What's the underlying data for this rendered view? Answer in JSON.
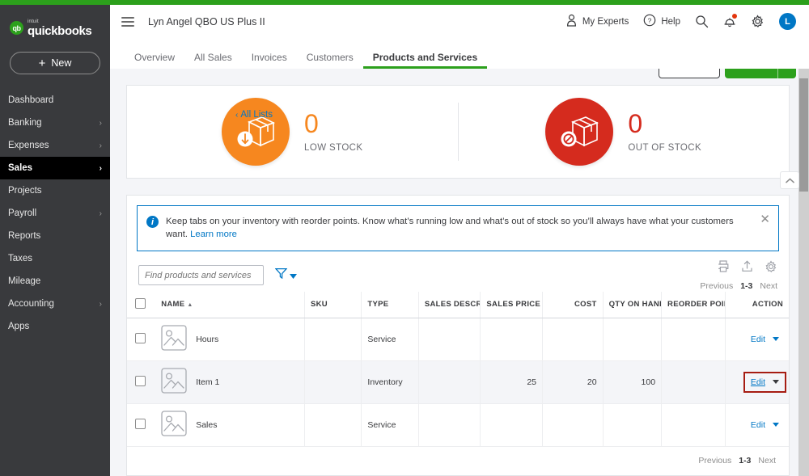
{
  "colors": {
    "brand_green": "#2CA01C",
    "sidebar_bg": "#393A3D",
    "link_blue": "#0077C5",
    "low_stock_orange": "#F6871F",
    "out_of_stock_red": "#D52B1E",
    "annotation_red": "#A61C12"
  },
  "sidebar": {
    "logo_intuit": "intuit",
    "logo_name": "quickbooks",
    "logo_mark": "qb",
    "new_button": "New",
    "items": [
      {
        "label": "Dashboard",
        "has_chevron": false,
        "active": false
      },
      {
        "label": "Banking",
        "has_chevron": true,
        "active": false
      },
      {
        "label": "Expenses",
        "has_chevron": true,
        "active": false
      },
      {
        "label": "Sales",
        "has_chevron": true,
        "active": true
      },
      {
        "label": "Projects",
        "has_chevron": false,
        "active": false
      },
      {
        "label": "Payroll",
        "has_chevron": true,
        "active": false
      },
      {
        "label": "Reports",
        "has_chevron": false,
        "active": false
      },
      {
        "label": "Taxes",
        "has_chevron": false,
        "active": false
      },
      {
        "label": "Mileage",
        "has_chevron": false,
        "active": false
      },
      {
        "label": "Accounting",
        "has_chevron": true,
        "active": false
      },
      {
        "label": "Apps",
        "has_chevron": false,
        "active": false
      }
    ]
  },
  "header": {
    "company_name": "Lyn Angel QBO US Plus II",
    "my_experts": "My Experts",
    "help": "Help",
    "avatar_initial": "L"
  },
  "tabs": [
    {
      "label": "Overview",
      "active": false
    },
    {
      "label": "All Sales",
      "active": false
    },
    {
      "label": "Invoices",
      "active": false
    },
    {
      "label": "Customers",
      "active": false
    },
    {
      "label": "Products and Services",
      "active": true
    }
  ],
  "page": {
    "title": "Products and Services",
    "back_link": "All Lists",
    "back_caret": "‹"
  },
  "stock_cards": [
    {
      "count": "0",
      "label": "LOW STOCK",
      "state": "low"
    },
    {
      "count": "0",
      "label": "OUT OF STOCK",
      "state": "out"
    }
  ],
  "banner": {
    "text": "Keep tabs on your inventory with reorder points. Know what’s running low and what’s out of stock so you’ll always have what your customers want. ",
    "link": "Learn more",
    "close": "✕"
  },
  "toolbar": {
    "search_placeholder": "Find products and services",
    "search_value": "",
    "icons": [
      "print-icon",
      "export-icon",
      "gear-icon"
    ]
  },
  "pagination": {
    "previous": "Previous",
    "range": "1-3",
    "next": "Next"
  },
  "table": {
    "columns": [
      {
        "label": "NAME",
        "align": "left",
        "sorted": true,
        "sort_caret": "▲"
      },
      {
        "label": "SKU",
        "align": "left"
      },
      {
        "label": "TYPE",
        "align": "left"
      },
      {
        "label": "SALES DESCRIPT",
        "align": "left"
      },
      {
        "label": "SALES PRICE",
        "align": "left"
      },
      {
        "label": "COST",
        "align": "right"
      },
      {
        "label": "QTY ON HAND",
        "align": "right"
      },
      {
        "label": "REORDER POINT",
        "align": "left"
      },
      {
        "label": "ACTION",
        "align": "right"
      }
    ],
    "rows": [
      {
        "name": "Hours",
        "sku": "",
        "type": "Service",
        "sales_description": "",
        "sales_price": "",
        "cost": "",
        "qty_on_hand": "",
        "reorder_point": "",
        "action": "Edit",
        "focused": false
      },
      {
        "name": "Item 1",
        "sku": "",
        "type": "Inventory",
        "sales_description": "",
        "sales_price": "25",
        "cost": "20",
        "qty_on_hand": "100",
        "reorder_point": "",
        "action": "Edit",
        "focused": true
      },
      {
        "name": "Sales",
        "sku": "",
        "type": "Service",
        "sales_description": "",
        "sales_price": "",
        "cost": "",
        "qty_on_hand": "",
        "reorder_point": "",
        "action": "Edit",
        "focused": false
      }
    ]
  }
}
